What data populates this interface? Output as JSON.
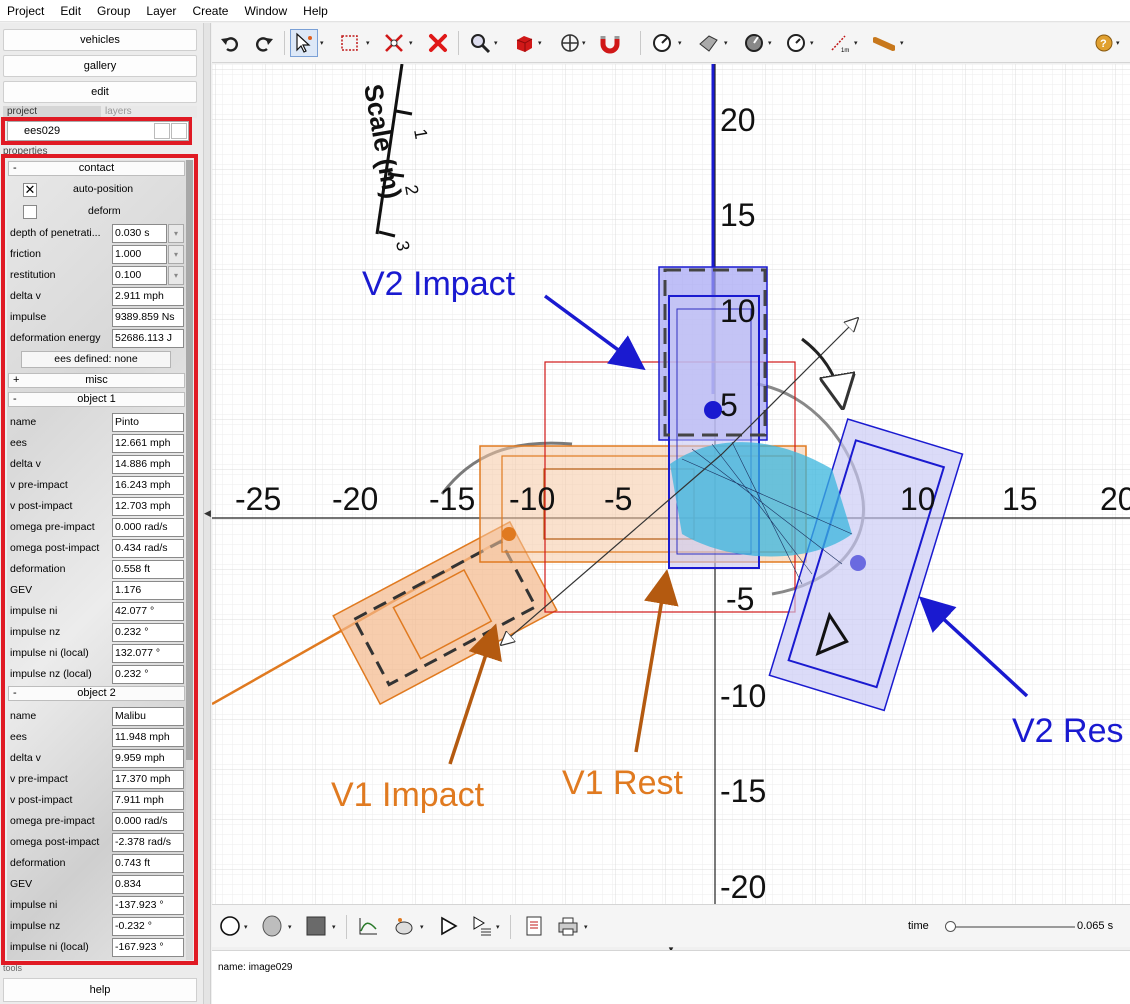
{
  "menubar": [
    "Project",
    "Edit",
    "Group",
    "Layer",
    "Create",
    "Window",
    "Help"
  ],
  "left": {
    "nav": [
      "vehicles",
      "gallery",
      "edit"
    ],
    "tabs": {
      "project": "project",
      "layers": "layers"
    },
    "project_name": "ees029",
    "properties_label": "properties",
    "contact": {
      "title": "contact",
      "auto_position": "auto-position",
      "deform": "deform",
      "rows": [
        {
          "label": "depth of penetrati...",
          "value": "0.030 s"
        },
        {
          "label": "friction",
          "value": "1.000"
        },
        {
          "label": "restitution",
          "value": "0.100"
        },
        {
          "label": "delta v",
          "value": "2.911 mph"
        },
        {
          "label": "impulse",
          "value": "9389.859 Ns"
        },
        {
          "label": "deformation energy",
          "value": "52686.113 J"
        }
      ],
      "ees_button": "ees defined: none"
    },
    "misc": "misc",
    "object1": {
      "title": "object 1",
      "rows": [
        {
          "label": "name",
          "value": "Pinto"
        },
        {
          "label": "ees",
          "value": "12.661 mph"
        },
        {
          "label": "delta v",
          "value": "14.886 mph"
        },
        {
          "label": "v pre-impact",
          "value": "16.243 mph"
        },
        {
          "label": "v post-impact",
          "value": "12.703 mph"
        },
        {
          "label": "omega pre-impact",
          "value": "0.000 rad/s"
        },
        {
          "label": "omega post-impact",
          "value": "0.434 rad/s"
        },
        {
          "label": "deformation",
          "value": "0.558 ft"
        },
        {
          "label": "GEV",
          "value": "1.176"
        },
        {
          "label": "impulse ni",
          "value": "42.077 °"
        },
        {
          "label": "impulse nz",
          "value": "0.232 °"
        },
        {
          "label": "impulse ni (local)",
          "value": "132.077 °"
        },
        {
          "label": "impulse nz (local)",
          "value": "0.232 °"
        }
      ]
    },
    "object2": {
      "title": "object 2",
      "rows": [
        {
          "label": "name",
          "value": "Malibu"
        },
        {
          "label": "ees",
          "value": "11.948 mph"
        },
        {
          "label": "delta v",
          "value": "9.959 mph"
        },
        {
          "label": "v pre-impact",
          "value": "17.370 mph"
        },
        {
          "label": "v post-impact",
          "value": "7.911 mph"
        },
        {
          "label": "omega pre-impact",
          "value": "0.000 rad/s"
        },
        {
          "label": "omega post-impact",
          "value": "-2.378 rad/s"
        },
        {
          "label": "deformation",
          "value": "0.743 ft"
        },
        {
          "label": "GEV",
          "value": "0.834"
        },
        {
          "label": "impulse ni",
          "value": "-137.923 °"
        },
        {
          "label": "impulse nz",
          "value": "-0.232 °"
        },
        {
          "label": "impulse ni (local)",
          "value": "-167.923 °"
        }
      ]
    },
    "tools_label": "tools",
    "help": "help"
  },
  "canvas": {
    "x_ticks": [
      "-25",
      "-20",
      "-15",
      "-10",
      "-5",
      "10",
      "15",
      "20"
    ],
    "y_ticks": [
      "20",
      "15",
      "10",
      "5",
      "-5",
      "-10",
      "-15",
      "-20"
    ],
    "scale_title": "Scale (m)",
    "scale_marks": [
      "1",
      "2",
      "3"
    ],
    "labels": {
      "v2_impact": "V2 Impact",
      "v2_rest": "V2 Res",
      "v1_impact": "V1 Impact",
      "v1_rest": "V1 Rest"
    },
    "colors": {
      "blue": "#1515c8",
      "orange": "#e07a20",
      "red_box": "#e01a24"
    }
  },
  "bottom": {
    "time_label": "time",
    "time_value": "0.065 s",
    "time_fraction": 0.0,
    "status": "name: image029"
  }
}
